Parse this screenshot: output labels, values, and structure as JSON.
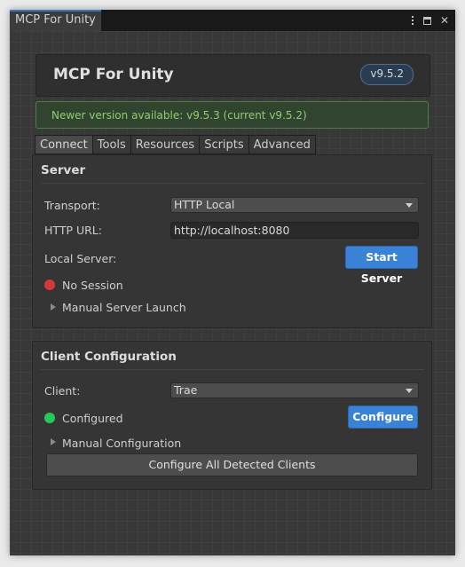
{
  "window": {
    "tab_title": "MCP For Unity"
  },
  "header": {
    "title": "MCP For Unity",
    "version": "v9.5.2"
  },
  "update_banner": {
    "text": "Newer version available: v9.5.3 (current v9.5.2)"
  },
  "tabs": [
    {
      "label": "Connect",
      "active": true
    },
    {
      "label": "Tools"
    },
    {
      "label": "Resources"
    },
    {
      "label": "Scripts"
    },
    {
      "label": "Advanced"
    }
  ],
  "server": {
    "title": "Server",
    "transport_label": "Transport:",
    "transport_value": "HTTP Local",
    "url_label": "HTTP URL:",
    "url_value": "http://localhost:8080",
    "local_server_label": "Local Server:",
    "start_button": "Start Server",
    "status_text": "No Session",
    "manual_launch": "Manual Server Launch"
  },
  "client": {
    "title": "Client Configuration",
    "client_label": "Client:",
    "client_value": "Trae",
    "status_text": "Configured",
    "configure_button": "Configure",
    "manual_config": "Manual Configuration",
    "configure_all_button": "Configure All Detected Clients"
  },
  "colors": {
    "accent": "#3a82d6",
    "status_error": "#d23a3a",
    "status_ok": "#27c75a",
    "banner_text": "#8fce6e"
  }
}
